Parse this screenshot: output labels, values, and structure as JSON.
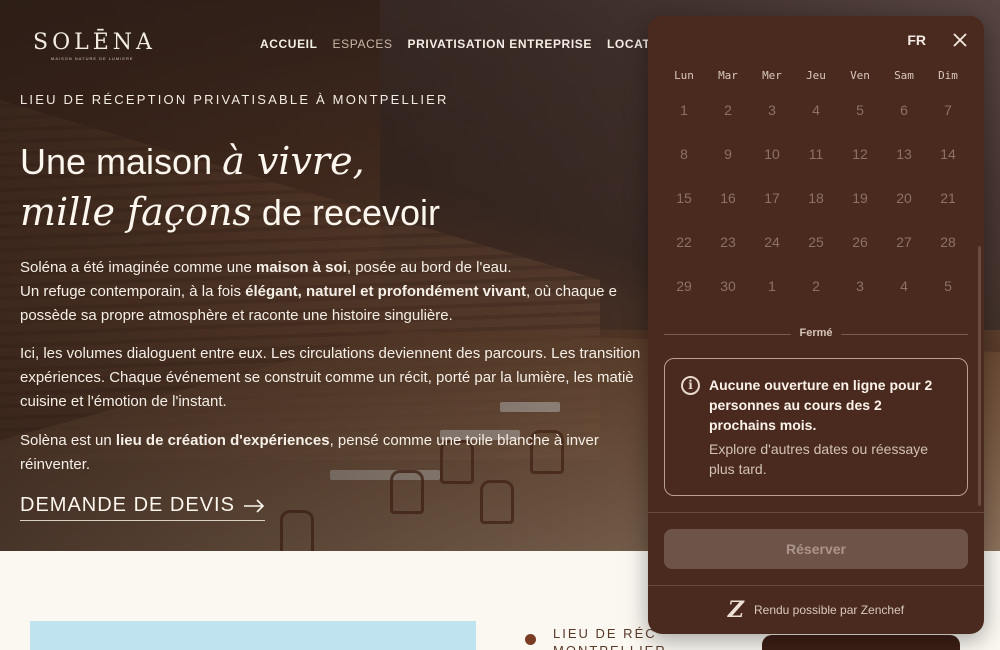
{
  "brand": {
    "name": "SOLĒNA",
    "tagline": "MAISON NATURE DE LUMIERE"
  },
  "nav": [
    "ACCUEIL",
    "ESPACES",
    "PRIVATISATION ENTREPRISE",
    "LOCATION"
  ],
  "hero": {
    "kicker": "LIEU DE RÉCEPTION PRIVATISABLE À MONTPELLIER",
    "h1_part1": "Une maison ",
    "h1_italic1": "à vivre,",
    "h1_italic2": "mille façons",
    "h1_part2": " de recevoir",
    "p1_a": "Soléna a été imaginée comme une ",
    "p1_b": "maison à soi",
    "p1_c": ", posée au bord de l'eau.",
    "p2_a": "Un refuge contemporain, à la fois ",
    "p2_b": "élégant, naturel et profondément vivant",
    "p2_c": ", où chaque e",
    "p3": "possède sa propre atmosphère et raconte une histoire singulière.",
    "p4": "Ici, les volumes dialoguent entre eux. Les circulations deviennent des parcours. Les transition",
    "p5": "expériences. Chaque événement se construit comme un récit, porté par la lumière, les matiè",
    "p6": "cuisine et l'émotion de l'instant.",
    "p7_a": "Solèna est un ",
    "p7_b": "lieu de création d'expériences",
    "p7_c": ", pensé comme une toile blanche à inver",
    "p8": "réinventer.",
    "cta": "DEMANDE DE DEVIS"
  },
  "below": {
    "kicker_l1": "LIEU DE RÉC",
    "kicker_l2": "MONTPELLIER"
  },
  "widget": {
    "lang": "FR",
    "weekdays": [
      "Lun",
      "Mar",
      "Mer",
      "Jeu",
      "Ven",
      "Sam",
      "Dim"
    ],
    "dates": [
      "1",
      "2",
      "3",
      "4",
      "5",
      "6",
      "7",
      "8",
      "9",
      "10",
      "11",
      "12",
      "13",
      "14",
      "15",
      "16",
      "17",
      "18",
      "19",
      "20",
      "21",
      "22",
      "23",
      "24",
      "25",
      "26",
      "27",
      "28",
      "29",
      "30",
      "1",
      "2",
      "3",
      "4",
      "5"
    ],
    "status": "Fermé",
    "info_title": "Aucune ouverture en ligne pour 2 personnes au cours des 2 prochains mois.",
    "info_sub": "Explore d'autres dates ou réessaye plus tard.",
    "reserve": "Réserver",
    "powered": "Rendu possible par Zenchef"
  },
  "colors": {
    "widget_bg": "#4a2a1e",
    "accent": "#7a3d24"
  }
}
